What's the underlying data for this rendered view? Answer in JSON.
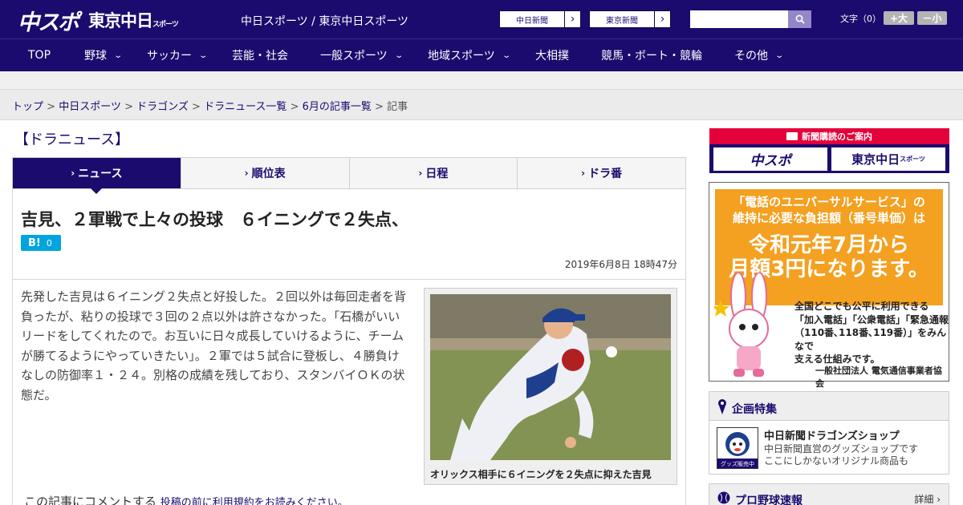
{
  "header": {
    "logo_chuspo": "中スポ",
    "logo_tokyo": "東京中日",
    "logo_tokyo_sub": "スポーツ",
    "site_title": "中日スポーツ / 東京中日スポーツ",
    "link_chunichi": "中日新聞",
    "link_tokyo": "東京新聞",
    "search_placeholder": "",
    "font_size_label": "文字（0）",
    "font_plus": "+大",
    "font_minus": "－小"
  },
  "nav": {
    "items": [
      {
        "label": "TOP",
        "has_menu": false
      },
      {
        "label": "野球",
        "has_menu": true
      },
      {
        "label": "サッカー",
        "has_menu": true
      },
      {
        "label": "芸能・社会",
        "has_menu": false
      },
      {
        "label": "一般スポーツ",
        "has_menu": true
      },
      {
        "label": "地域スポーツ",
        "has_menu": true
      },
      {
        "label": "大相撲",
        "has_menu": false
      },
      {
        "label": "競馬・ボート・競輪",
        "has_menu": false
      },
      {
        "label": "その他",
        "has_menu": true
      }
    ]
  },
  "breadcrumb": {
    "items": [
      "トップ",
      "中日スポーツ",
      "ドラゴンズ",
      "ドラニュース一覧",
      "6月の記事一覧"
    ],
    "separator": ">",
    "current": "記事"
  },
  "section": {
    "title": "【ドラニュース】"
  },
  "tabs": [
    {
      "label": "ニュース",
      "active": true
    },
    {
      "label": "順位表",
      "active": false
    },
    {
      "label": "日程",
      "active": false
    },
    {
      "label": "ドラ番",
      "active": false
    }
  ],
  "article": {
    "headline": "吉見、２軍戦で上々の投球　６イニングで２失点、",
    "hatena_label": "B!",
    "hatena_count": "0",
    "date": "2019年6月8日 18時47分",
    "body": "先発した吉見は６イニング２失点と好投した。２回以外は毎回走者を背負ったが、粘りの投球で３回の２点以外は許さなかった。「石橋がいいリードをしてくれたので。お互いに日々成長していけるように、チームが勝てるようにやっていきたい」。２軍では５試合に登板し、４勝負けなしの防御率１・２４。別格の成績を残しており、スタンバイＯＫの状態だ。",
    "photo_caption": "オリックス相手に６イニングを２失点に抑えた吉見",
    "comment_prefix": "この記事にコメントする",
    "comment_link": "投稿の前に利用規約をお読みください。"
  },
  "sidebar": {
    "subscription_head": "新聞購読のご案内",
    "sub_logo_1": "中スポ",
    "sub_logo_2": "東京中日",
    "sub_logo_2_small": "スポーツ",
    "ad": {
      "line1": "「電話のユニバーサルサービス」の",
      "line2": "維持に必要な負担額（番号単価）は",
      "big1": "令和元年7月から",
      "big2": "月額3円になります。",
      "text1": "全国どこでも公平に利用できる",
      "text2": "「加入電話」「公衆電話」「緊急通報",
      "text3": "（110番､118番､119番）」をみんなで",
      "text4": "支える仕組みです。",
      "org": "一般社団法人 電気通信事業者協会"
    },
    "feature": {
      "title": "企画特集",
      "item_name": "中日新聞ドラゴンズショップ",
      "item_desc1": "中日新聞直営のグッズショップです",
      "item_desc2": "ここにしかないオリジナル商品も",
      "thumb_text": "グッズ販売中"
    },
    "score": {
      "title": "プロ野球速報",
      "more": "詳細 ›"
    }
  },
  "colors": {
    "brand_navy": "#1b0b6e",
    "accent_red": "#e4003a",
    "ad_orange": "#f4a020",
    "hatena_blue": "#00a4de"
  }
}
